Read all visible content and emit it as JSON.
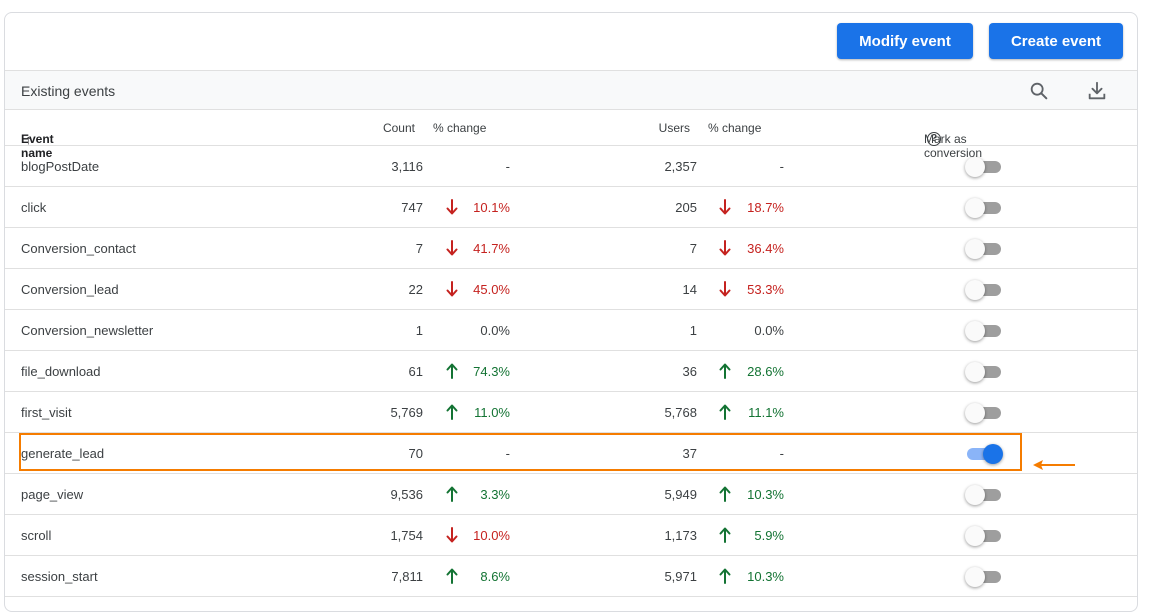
{
  "toolbar": {
    "modify_label": "Modify event",
    "create_label": "Create event"
  },
  "section": {
    "title": "Existing events",
    "search_icon": "search-icon",
    "download_icon": "download-icon"
  },
  "columns": {
    "event_name": "Event name",
    "count": "Count",
    "count_change": "% change",
    "users": "Users",
    "users_change": "% change",
    "conversion": "Mark as conversion",
    "help": "?"
  },
  "rows": [
    {
      "name": "blogPostDate",
      "count": "3,116",
      "count_dir": "none",
      "count_change": "-",
      "users": "2,357",
      "users_dir": "none",
      "users_change": "-",
      "conversion": false
    },
    {
      "name": "click",
      "count": "747",
      "count_dir": "down",
      "count_change": "10.1%",
      "users": "205",
      "users_dir": "down",
      "users_change": "18.7%",
      "conversion": false
    },
    {
      "name": "Conversion_contact",
      "count": "7",
      "count_dir": "down",
      "count_change": "41.7%",
      "users": "7",
      "users_dir": "down",
      "users_change": "36.4%",
      "conversion": false
    },
    {
      "name": "Conversion_lead",
      "count": "22",
      "count_dir": "down",
      "count_change": "45.0%",
      "users": "14",
      "users_dir": "down",
      "users_change": "53.3%",
      "conversion": false
    },
    {
      "name": "Conversion_newsletter",
      "count": "1",
      "count_dir": "none",
      "count_change": "0.0%",
      "users": "1",
      "users_dir": "none",
      "users_change": "0.0%",
      "conversion": false
    },
    {
      "name": "file_download",
      "count": "61",
      "count_dir": "up",
      "count_change": "74.3%",
      "users": "36",
      "users_dir": "up",
      "users_change": "28.6%",
      "conversion": false
    },
    {
      "name": "first_visit",
      "count": "5,769",
      "count_dir": "up",
      "count_change": "11.0%",
      "users": "5,768",
      "users_dir": "up",
      "users_change": "11.1%",
      "conversion": false
    },
    {
      "name": "generate_lead",
      "count": "70",
      "count_dir": "none",
      "count_change": "-",
      "users": "37",
      "users_dir": "none",
      "users_change": "-",
      "conversion": true
    },
    {
      "name": "page_view",
      "count": "9,536",
      "count_dir": "up",
      "count_change": "3.3%",
      "users": "5,949",
      "users_dir": "up",
      "users_change": "10.3%",
      "conversion": false
    },
    {
      "name": "scroll",
      "count": "1,754",
      "count_dir": "down",
      "count_change": "10.0%",
      "users": "1,173",
      "users_dir": "up",
      "users_change": "5.9%",
      "conversion": false
    },
    {
      "name": "session_start",
      "count": "7,811",
      "count_dir": "up",
      "count_change": "8.6%",
      "users": "5,971",
      "users_dir": "up",
      "users_change": "10.3%",
      "conversion": false
    }
  ],
  "colors": {
    "accent": "#1a73e8",
    "down": "#c5221f",
    "up": "#137333",
    "highlight": "#f57c00"
  }
}
